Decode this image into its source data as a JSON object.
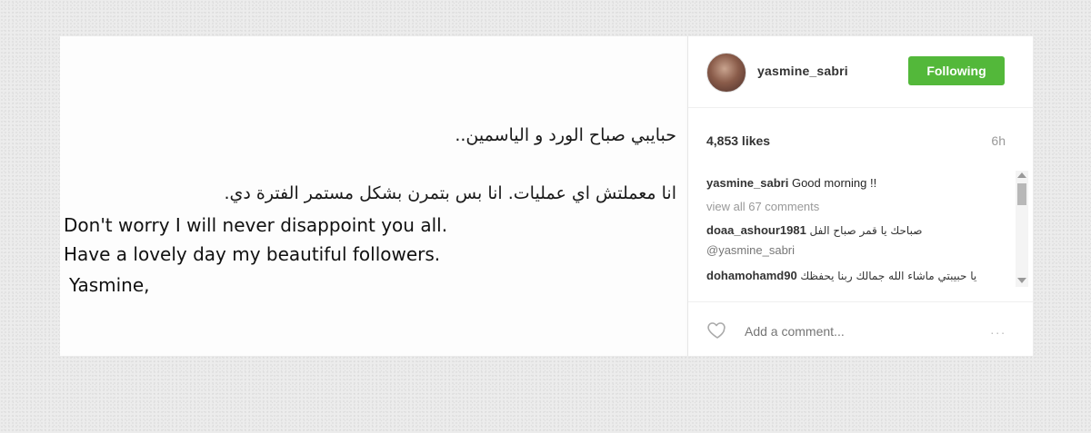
{
  "post": {
    "arabic_line1": "حبايبي صباح الورد و الياسمين..",
    "arabic_line2": "انا معملتش اي عمليات. انا بس بتمرن بشكل مستمر الفترة دي.",
    "english_line1": "Don't worry I will never disappoint you all.",
    "english_line2": "Have a lovely day my beautiful followers.",
    "english_line3": "Yasmine,"
  },
  "sidebar": {
    "username": "yasmine_sabri",
    "follow_button": "Following",
    "likes": "4,853 likes",
    "time": "6h",
    "caption_user": "yasmine_sabri",
    "caption_text": "Good morning !!",
    "view_all": "view all 67 comments",
    "comment1_user": "doaa_ashour1981",
    "comment1_text": "صباحك يا قمر صباح الفل",
    "comment1_mention": "@yasmine_sabri",
    "comment2_user": "dohamohamd90",
    "comment2_text": "يا حبيبتي ماشاء الله جمالك ربنا يحفظك",
    "add_comment_placeholder": "Add a comment...",
    "more": "..."
  },
  "icons": {
    "heart": "heart-icon",
    "scroll_up": "scroll-up-icon",
    "scroll_down": "scroll-down-icon"
  },
  "colors": {
    "follow_button": "#53b83a"
  }
}
